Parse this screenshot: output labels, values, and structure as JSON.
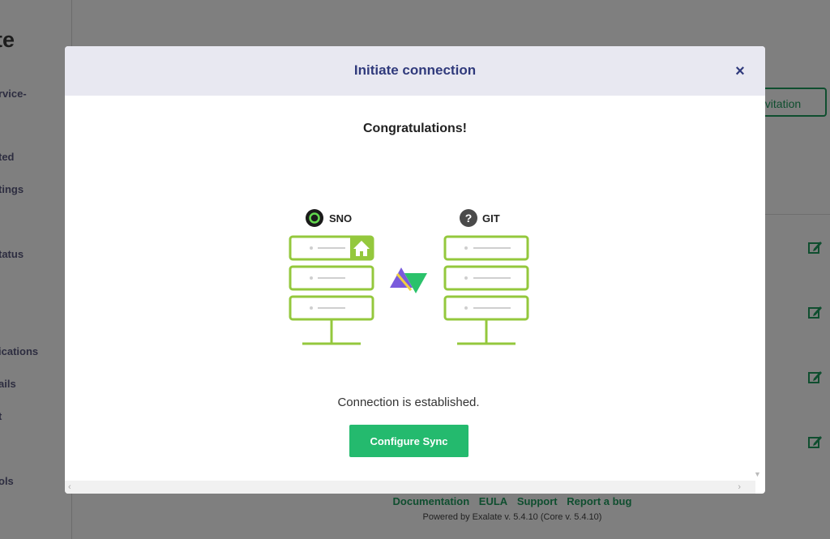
{
  "background": {
    "brand_fragment": "te",
    "sidebar_items": [
      "rvice-",
      "ted",
      "tings",
      "tatus",
      "ications",
      "ails",
      "t",
      "ols"
    ],
    "invite_button_label": "nvitation",
    "footer_links": [
      "Documentation",
      "EULA",
      "Support",
      "Report a bug"
    ],
    "powered_by": "Powered by Exalate v. 5.4.10 (Core v. 5.4.10)",
    "edit_icon": "edit-icon"
  },
  "modal": {
    "title": "Initiate connection",
    "close_icon": "close-icon",
    "heading": "Congratulations!",
    "left_node": {
      "label": "SNO",
      "icon": "servicenow-icon"
    },
    "right_node": {
      "label": "GIT",
      "icon": "question-icon"
    },
    "middle_icon": "exalate-logo",
    "status_text": "Connection is established.",
    "configure_button_label": "Configure Sync"
  },
  "colors": {
    "server_green": "#94c83d",
    "header_title": "#303a7c",
    "button_green": "#24ba6e",
    "footer_green": "#1e9c5e"
  }
}
